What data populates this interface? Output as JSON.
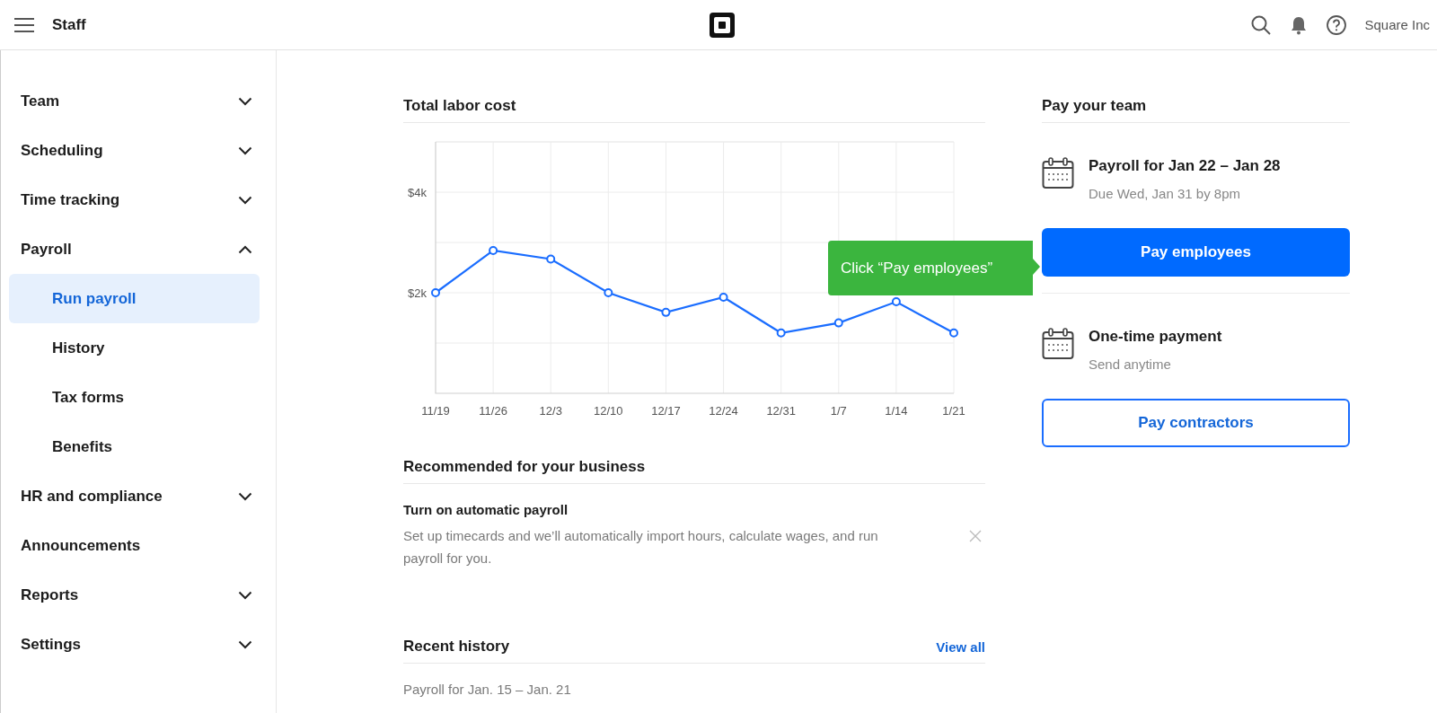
{
  "header": {
    "title": "Staff",
    "account": "Square Inc"
  },
  "sidebar": {
    "items": [
      {
        "label": "Team",
        "expanded": false
      },
      {
        "label": "Scheduling",
        "expanded": false
      },
      {
        "label": "Time tracking",
        "expanded": false
      },
      {
        "label": "Payroll",
        "expanded": true,
        "children": [
          {
            "label": "Run payroll",
            "selected": true
          },
          {
            "label": "History",
            "selected": false
          },
          {
            "label": "Tax forms",
            "selected": false
          },
          {
            "label": "Benefits",
            "selected": false
          }
        ]
      },
      {
        "label": "HR and compliance",
        "expanded": false
      },
      {
        "label": "Announcements"
      },
      {
        "label": "Reports",
        "expanded": false
      },
      {
        "label": "Settings",
        "expanded": false
      }
    ]
  },
  "labor_cost": {
    "title": "Total labor cost",
    "chart_data": {
      "type": "line",
      "categories": [
        "11/19",
        "11/26",
        "12/3",
        "12/10",
        "12/17",
        "12/24",
        "12/31",
        "1/7",
        "1/14",
        "1/21"
      ],
      "series": [
        {
          "color": "#1a6dff",
          "marker": true,
          "values": [
            2000,
            2840,
            2670,
            2000,
            1610,
            1910,
            1200,
            1400,
            1820,
            1200
          ]
        }
      ],
      "grid": true,
      "ylim": [
        0,
        5000
      ],
      "yticks": [
        {
          "value": 2000,
          "label": "$2k"
        },
        {
          "value": 4000,
          "label": "$4k"
        }
      ]
    }
  },
  "recommended": {
    "title": "Recommended for your business",
    "cards": [
      {
        "title": "Turn on automatic payroll",
        "description": "Set up timecards and we’ll automatically import hours, calculate wages, and run payroll for you."
      }
    ]
  },
  "recent_history": {
    "title": "Recent history",
    "link": "View all",
    "rows": [
      "Payroll for Jan. 15 – Jan. 21"
    ]
  },
  "pay_team": {
    "title": "Pay your team",
    "payments": [
      {
        "title": "Payroll for Jan 22 – Jan 28",
        "subtitle": "Due Wed, Jan 31 by 8pm",
        "button": "Pay employees",
        "kind": "primary",
        "tooltip": "Click “Pay employees”"
      },
      {
        "title": "One-time payment",
        "subtitle": "Send anytime",
        "button": "Pay contractors",
        "kind": "secondary"
      }
    ]
  }
}
